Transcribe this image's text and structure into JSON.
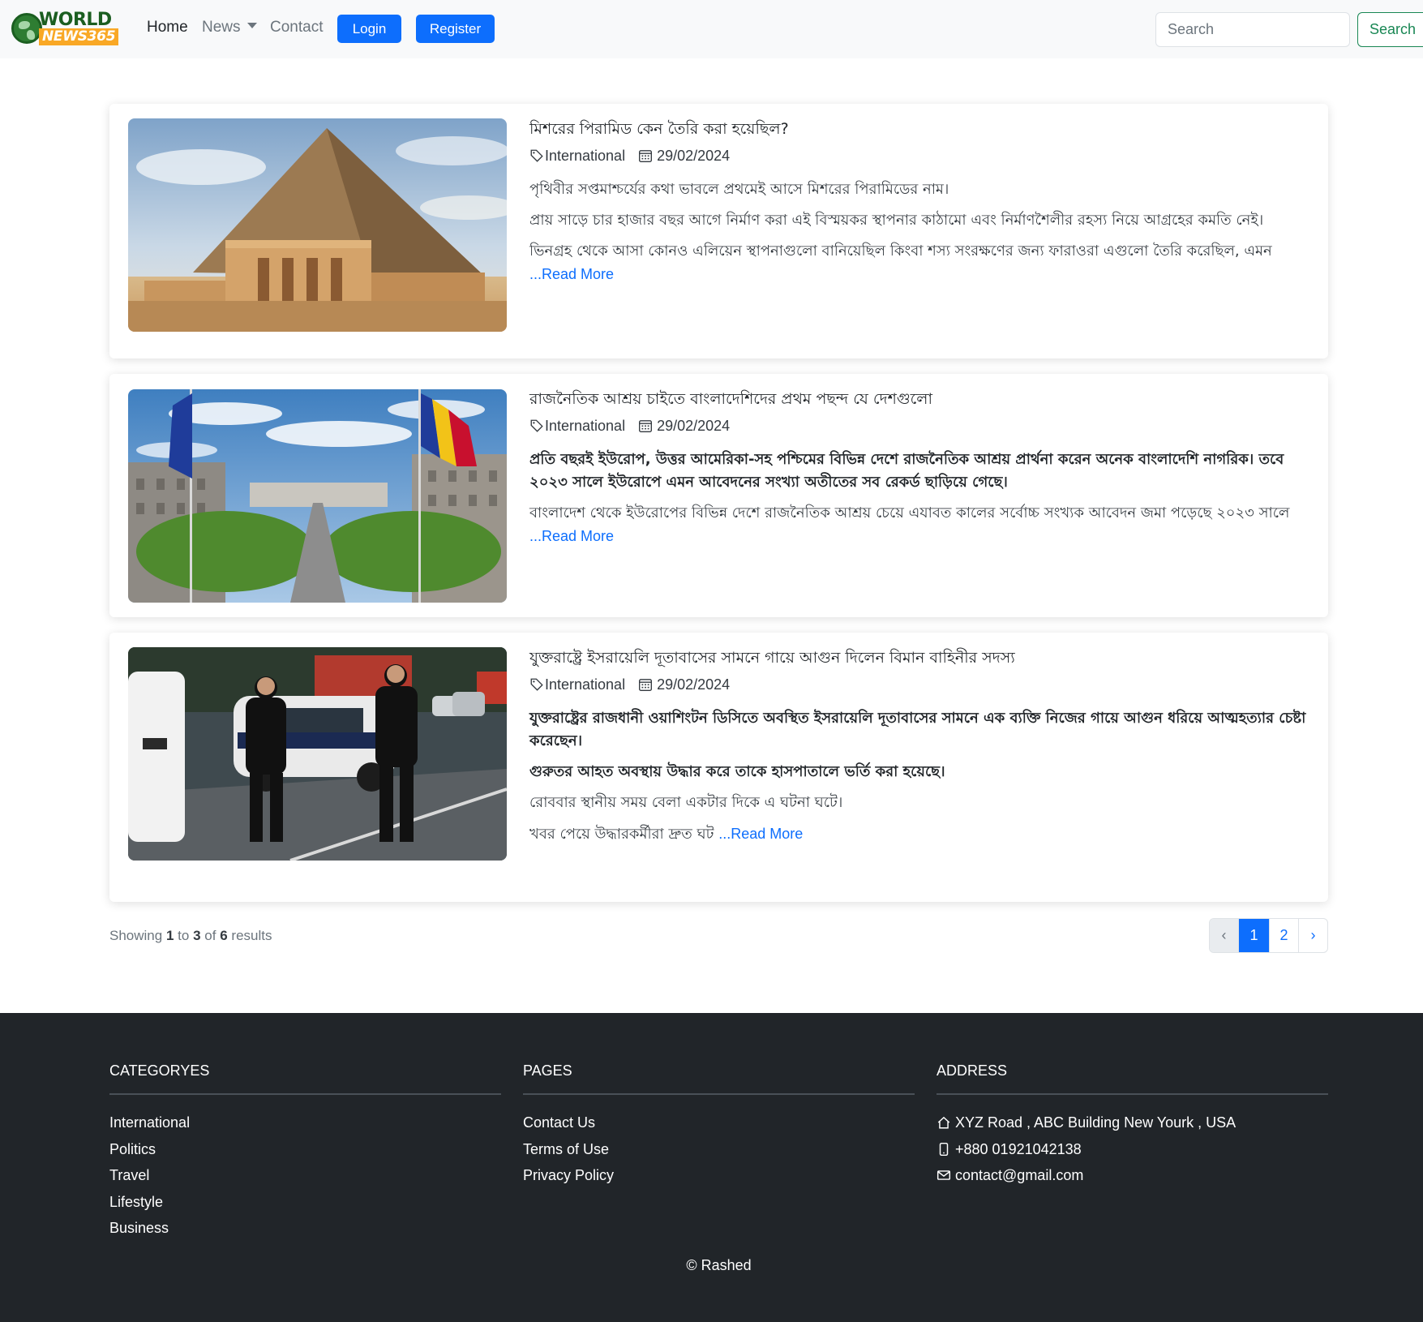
{
  "brand": {
    "line1": "WORLD",
    "line2": "NEWS365"
  },
  "nav": {
    "home": "Home",
    "news": "News",
    "contact": "Contact",
    "login": "Login",
    "register": "Register"
  },
  "search": {
    "placeholder": "Search",
    "button": "Search"
  },
  "articles": [
    {
      "title": "মিশরের পিরামিড কেন তৈরি করা হয়েছিল?",
      "category": "International",
      "date": "29/02/2024",
      "image": "pyramid-photo",
      "paragraphs": [
        "পৃথিবীর সপ্তমাশ্চর্যের কথা ভাবলে প্রথমেই আসে মিশরের পিরামিডের নাম।",
        "প্রায় সাড়ে চার হাজার বছর আগে নির্মাণ করা এই বিস্ময়কর স্থাপনার কাঠামো এবং নির্মাণশৈলীর রহস্য নিয়ে আগ্রহের কমতি নেই।",
        "ভিনগ্রহ থেকে আসা কোনও এলিয়েন স্থাপনাগুলো বানিয়েছিল কিংবা শস্য সংরক্ষণের জন্য ফারাওরা এগুলো তৈরি করেছিল, এমন"
      ],
      "read_more": "...Read More"
    },
    {
      "title": "রাজনৈতিক আশ্রয় চাইতে বাংলাদেশিদের প্রথম পছন্দ যে দেশগুলো",
      "category": "International",
      "date": "29/02/2024",
      "image": "boulevard-flags-photo",
      "paragraphs": [
        "প্রতি বছরই ইউরোপ, উত্তর আমেরিকা-সহ পশ্চিমের বিভিন্ন দেশে রাজনৈতিক আশ্রয় প্রার্থনা করেন অনেক বাংলাদেশি নাগরিক। তবে ২০২৩ সালে ইউরোপে এমন আবেদনের সংখ্যা অতীতের সব রেকর্ড ছাড়িয়ে গেছে।",
        "বাংলাদেশ থেকে ইউরোপের বিভিন্ন দেশে রাজনৈতিক আশ্রয় চেয়ে এযাবত কালের সর্বোচ্চ সংখ্যক আবেদন জমা পড়েছে ২০২৩ সালে"
      ],
      "read_more": "...Read More"
    },
    {
      "title": "যুক্তরাষ্ট্রে ইসরায়েলি দূতাবাসের সামনে গায়ে আগুন দিলেন বিমান বাহিনীর সদস্য",
      "category": "International",
      "date": "29/02/2024",
      "image": "police-officers-photo",
      "paragraphs": [
        "যুক্তরাষ্ট্রের রাজধানী ওয়াশিংটন ডিসিতে অবস্থিত ইসরায়েলি দূতাবাসের সামনে এক ব্যক্তি নিজের গায়ে আগুন ধরিয়ে আত্মহত্যার চেষ্টা করেছেন।",
        "গুরুতর আহত অবস্থায় উদ্ধার করে তাকে হাসপাতালে ভর্তি করা হয়েছে।",
        "রোববার স্থানীয় সময় বেলা একটার দিকে এ ঘটনা ঘটে।",
        "খবর পেয়ে উদ্ধারকর্মীরা দ্রুত ঘট"
      ],
      "read_more": "...Read More"
    }
  ],
  "pagination": {
    "showing": "Showing",
    "from": "1",
    "to_word": "to",
    "to": "3",
    "of_word": "of",
    "total": "6",
    "results_word": "results",
    "prev": "‹",
    "pages": [
      "1",
      "2"
    ],
    "current": "1",
    "next": "›"
  },
  "footer": {
    "categories": {
      "heading": "CATEGORYES",
      "items": [
        "International",
        "Politics",
        "Travel",
        "Lifestyle",
        "Business"
      ]
    },
    "pages": {
      "heading": "PAGES",
      "items": [
        "Contact Us",
        "Terms of Use",
        "Privacy Policy"
      ]
    },
    "address": {
      "heading": "ADDRESS",
      "street": "XYZ Road , ABC Building New Yourk , USA",
      "phone": "+880 01921042138",
      "email": "contact@gmail.com"
    },
    "copyright": "© Rashed"
  }
}
